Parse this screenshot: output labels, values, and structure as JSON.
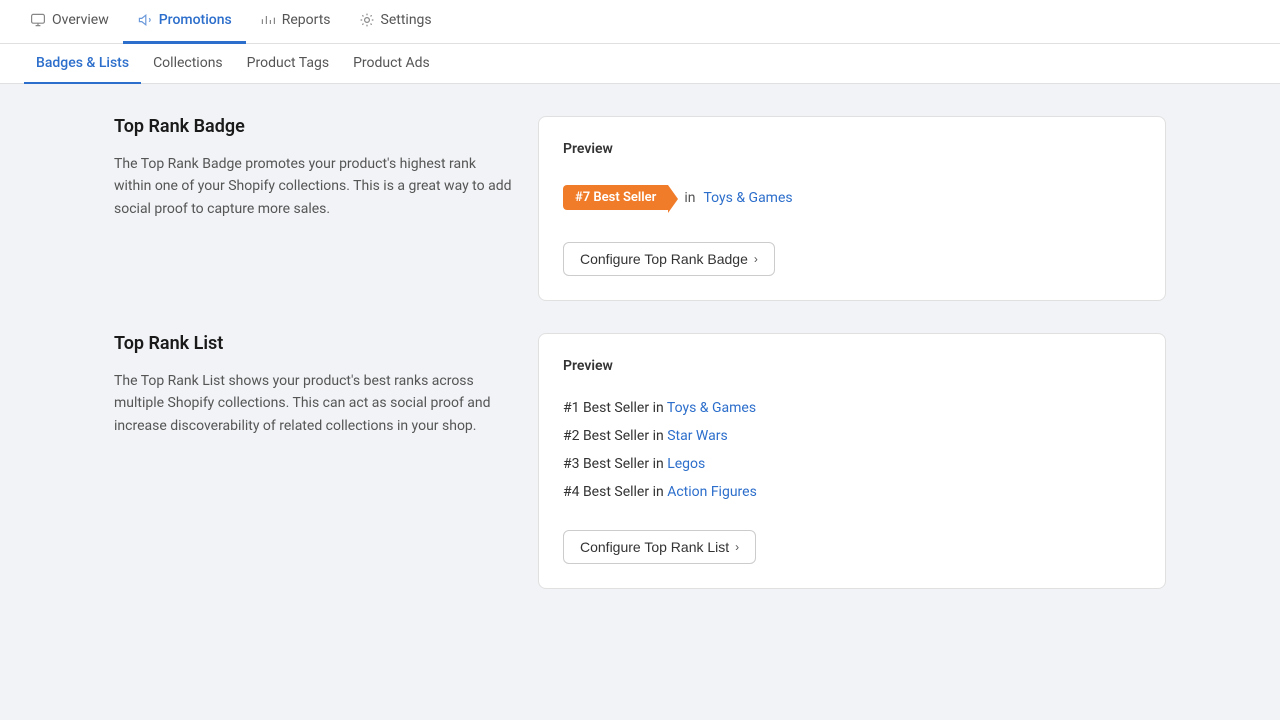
{
  "topNav": {
    "items": [
      {
        "id": "overview",
        "label": "Overview",
        "icon": "monitor",
        "active": false
      },
      {
        "id": "promotions",
        "label": "Promotions",
        "icon": "megaphone",
        "active": true
      },
      {
        "id": "reports",
        "label": "Reports",
        "icon": "chart",
        "active": false
      },
      {
        "id": "settings",
        "label": "Settings",
        "icon": "gear",
        "active": false
      }
    ]
  },
  "subNav": {
    "items": [
      {
        "id": "badges-lists",
        "label": "Badges & Lists",
        "active": true
      },
      {
        "id": "collections",
        "label": "Collections",
        "active": false
      },
      {
        "id": "product-tags",
        "label": "Product Tags",
        "active": false
      },
      {
        "id": "product-ads",
        "label": "Product Ads",
        "active": false
      }
    ]
  },
  "sections": {
    "topRankBadge": {
      "title": "Top Rank Badge",
      "description": "The Top Rank Badge promotes your product's highest rank within one of your Shopify collections. This is a great way to add social proof to capture more sales.",
      "preview": {
        "label": "Preview",
        "badge": {
          "text": "#7 Best Seller",
          "inText": "in",
          "collectionLink": "Toys & Games"
        },
        "configureButton": "Configure Top Rank Badge"
      }
    },
    "topRankList": {
      "title": "Top Rank List",
      "description": "The Top Rank List shows your product's best ranks across multiple Shopify collections. This can act as social proof and increase discoverability of related collections in your shop.",
      "preview": {
        "label": "Preview",
        "items": [
          {
            "rank": "#1",
            "text": "Best Seller in",
            "collection": "Toys & Games"
          },
          {
            "rank": "#2",
            "text": "Best Seller in",
            "collection": "Star Wars"
          },
          {
            "rank": "#3",
            "text": "Best Seller in",
            "collection": "Legos"
          },
          {
            "rank": "#4",
            "text": "Best Seller in",
            "collection": "Action Figures"
          }
        ],
        "configureButton": "Configure Top Rank List"
      }
    }
  },
  "colors": {
    "badgeOrange": "#f07c2a",
    "linkBlue": "#2c6ecb",
    "activeNav": "#2c6ecb"
  }
}
